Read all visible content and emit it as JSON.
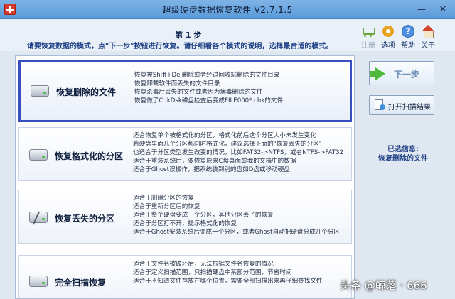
{
  "window": {
    "title": "超级硬盘数据恢复软件 V2.7.1.5",
    "minimize": "—",
    "close": "✕"
  },
  "header": {
    "step": "第 1 步",
    "instruction": "请要恢复数据的模式，点\"下一步\"按钮进行恢复。请仔细看各个模式的说明，选择最合适的模式。"
  },
  "toolbar": {
    "register": {
      "label": "注册",
      "icon": "cart-icon",
      "enabled": false
    },
    "options": {
      "label": "选项",
      "icon": "gear-icon"
    },
    "help": {
      "label": "帮助",
      "icon": "help-icon"
    },
    "about": {
      "label": "关于",
      "icon": "home-icon"
    }
  },
  "modes": [
    {
      "title": "恢复删除的文件",
      "selected": true,
      "icon": "disk-icon",
      "lines": [
        "恢复被Shift+Del删除或者经过回收站删除的文件目录",
        "恢复卸载软件而丢失的文件目录",
        "恢复杀毒后丢失的文件或者因为病毒删除的文件",
        "恢复做了ChkDsk磁盘检查后变成FILE000*.chk的文件"
      ]
    },
    {
      "title": "恢复格式化的分区",
      "icon": "disk-icon",
      "lines": [
        "适合恢复单个被格式化的分区，格式化前后这个分区大小未发生变化",
        "若硬盘里面几个分区都同时格式化，建议选择下面的\"恢复丢失的分区\"",
        "也适合于分区类型发生改变的情况，比如FAT32->NTFS，或者NTFS->FAT32",
        "适合于重装系统后，要恢复原来C盘桌面或我的文档中的数据",
        "适合于Ghost误操作，把系统装到别的盘如D盘或移动硬盘"
      ]
    },
    {
      "title": "恢复丢失的分区",
      "icon": "broken-disk-icon",
      "lines": [
        "适合于删除分区的恢复",
        "适合于重新分区后的恢复",
        "适合于整个硬盘变成一个分区，其他分区丢了的恢复",
        "适合于分区打不开，提示格式化的恢复",
        "适合于Ghost安装系统后变成一个分区，或者Ghost自动把硬盘分成几个分区"
      ]
    },
    {
      "title": "完全扫描恢复",
      "icon": "disk-icon",
      "lines": [
        "适合于文件名被破坏后，无法根据文件名恢复的情况",
        "适合于定义扫描范围，只扫描硬盘中某部分范围，节省时间",
        "适合于不知道文件存放在哪个位置，需要全部扫描出来再仔细查找文件"
      ]
    }
  ],
  "actions": {
    "next": "下一步",
    "open_results": "打开扫描结果"
  },
  "selection": {
    "label": "已选信息:",
    "value": "恢复删除的文件"
  },
  "watermark": "头条 @鲸落 · 666"
}
